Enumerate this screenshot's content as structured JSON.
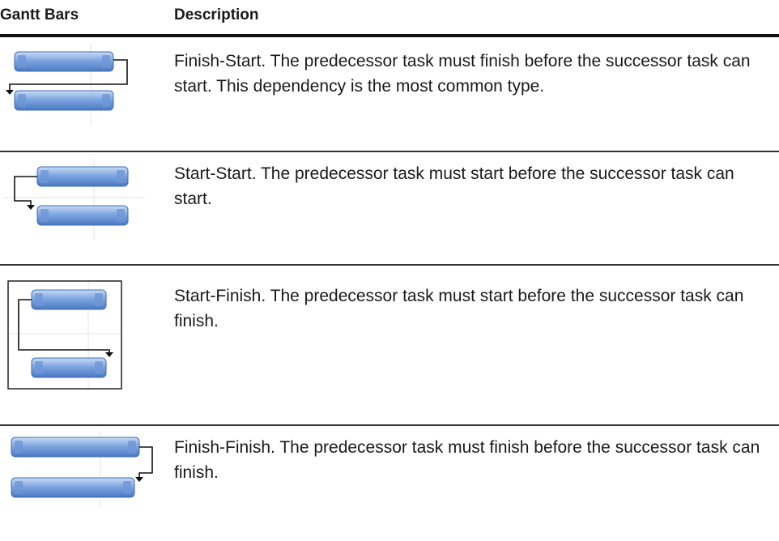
{
  "header": {
    "gantt_bars": "Gantt Bars",
    "description": "Description"
  },
  "rows": [
    {
      "icon": "finish-start-dependency-icon",
      "description": "Finish-Start. The predecessor task must finish before the successor task can start. This dependency is the most common type."
    },
    {
      "icon": "start-start-dependency-icon",
      "description": "Start-Start. The predecessor task must start before the successor task can start."
    },
    {
      "icon": "start-finish-dependency-icon",
      "description": "Start-Finish. The predecessor task must start before the successor task can finish."
    },
    {
      "icon": "finish-finish-dependency-icon",
      "description": "Finish-Finish. The predecessor task must finish before the successor task can finish."
    }
  ],
  "colors": {
    "bar_fill_top": "#a9c6ee",
    "bar_fill_bottom": "#4f7fc9",
    "bar_border": "#3d6db5",
    "connector": "#111111",
    "rule": "#111111"
  }
}
